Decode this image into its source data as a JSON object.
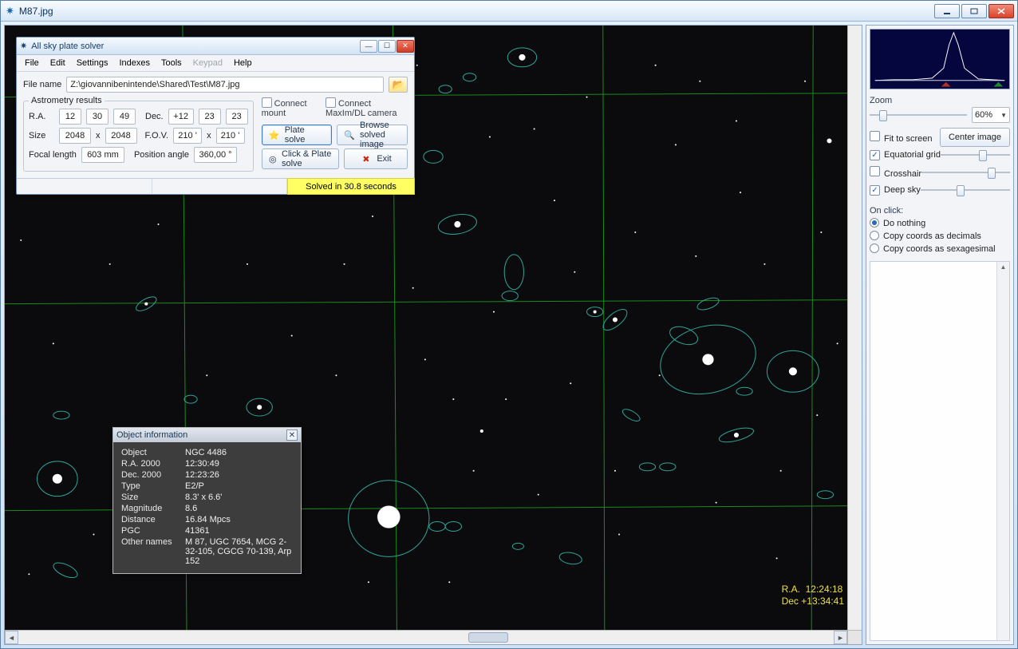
{
  "window": {
    "title": "M87.jpg"
  },
  "solver": {
    "title": "All sky plate solver",
    "menu": [
      "File",
      "Edit",
      "Settings",
      "Indexes",
      "Tools",
      "Keypad",
      "Help"
    ],
    "menu_disabled_index": 5,
    "file_name_label": "File name",
    "file_name_value": "Z:\\giovannibenintende\\Shared\\Test\\M87.jpg",
    "astro_legend": "Astrometry results",
    "labels": {
      "ra": "R.A.",
      "dec": "Dec.",
      "size": "Size",
      "fov": "F.O.V.",
      "focal": "Focal length",
      "pos_angle": "Position angle"
    },
    "ra": [
      "12",
      "30",
      "49"
    ],
    "dec": [
      "+12",
      "23",
      "23"
    ],
    "size": [
      "2048",
      "2048"
    ],
    "size_mid": "x",
    "fov": [
      "210 '",
      "210 '"
    ],
    "fov_mid": "x",
    "focal": "603 mm",
    "pos_angle": "360,00 °",
    "cbs": {
      "connect_mount": "Connect mount",
      "connect_maxim": "Connect MaxIm/DL camera"
    },
    "buttons": {
      "plate_solve": "Plate solve",
      "browse": "Browse solved image",
      "click_plate": "Click & Plate solve",
      "exit": "Exit"
    },
    "status": "Solved in 30.8 seconds"
  },
  "readout": {
    "ra_label": "R.A.",
    "ra_val": "12:24:18",
    "dec_label": "Dec",
    "dec_val": "+13:34:41"
  },
  "object_info": {
    "title": "Object information",
    "rows": [
      {
        "k": "Object",
        "v": "NGC 4486"
      },
      {
        "k": "R.A. 2000",
        "v": "12:30:49"
      },
      {
        "k": "Dec. 2000",
        "v": "12:23:26"
      },
      {
        "k": "Type",
        "v": "E2/P"
      },
      {
        "k": "Size",
        "v": "8.3' x 6.6'"
      },
      {
        "k": "Magnitude",
        "v": "8.6"
      },
      {
        "k": "Distance",
        "v": "16.84 Mpcs"
      },
      {
        "k": "PGC",
        "v": "41361"
      },
      {
        "k": "Other names",
        "v": "M 87, UGC 7654, MCG 2-32-105, CGCG 70-139, Arp 152"
      }
    ]
  },
  "right": {
    "zoom_label": "Zoom",
    "zoom_value": "60%",
    "fit": "Fit to screen",
    "center": "Center image",
    "eqgrid": "Equatorial grid",
    "crosshair": "Crosshair",
    "deepsky": "Deep sky",
    "onclick_label": "On click:",
    "onclick_opts": [
      "Do nothing",
      "Copy coords as decimals",
      "Copy coords as sexagesimal"
    ]
  }
}
